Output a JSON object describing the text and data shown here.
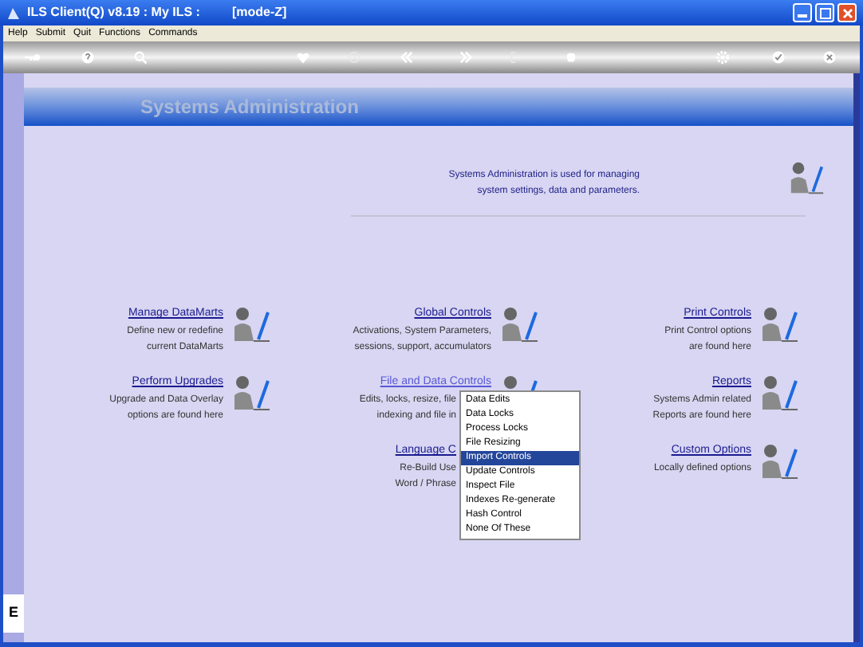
{
  "window": {
    "title": "ILS Client(Q) v8.19 : My ILS :",
    "mode": "[mode-Z]"
  },
  "menu_bar": [
    "Help",
    "Submit",
    "Quit",
    "Functions",
    "Commands"
  ],
  "page_title": "Systems Administration",
  "intro": [
    "Systems Administration is used for managing",
    "system settings, data and parameters."
  ],
  "sections": [
    {
      "title": "Manage DataMarts",
      "active": false,
      "lines": [
        "Define new or redefine",
        "current DataMarts"
      ]
    },
    {
      "title": "Global Controls",
      "active": false,
      "lines": [
        "Activations, System Parameters,",
        "sessions, support, accumulators"
      ]
    },
    {
      "title": "Print Controls",
      "active": false,
      "lines": [
        "Print Control options",
        "are found here"
      ]
    },
    {
      "title": "Perform Upgrades",
      "active": false,
      "lines": [
        "Upgrade and Data Overlay",
        "options are found here"
      ]
    },
    {
      "title": "File and Data Controls",
      "active": true,
      "lines": [
        "Edits, locks, resize, file",
        "indexing and file in"
      ]
    },
    {
      "title": "Reports",
      "active": false,
      "lines": [
        "Systems Admin related",
        "Reports are found here"
      ]
    },
    {
      "kind": "empty"
    },
    {
      "title": "Language C",
      "active": false,
      "lines": [
        "Re-Build Use",
        "Word / Phrase"
      ]
    },
    {
      "title": "Custom Options",
      "active": false,
      "lines": [
        "Locally defined options"
      ]
    }
  ],
  "popup_menu": [
    {
      "label": "Data Edits",
      "selected": false
    },
    {
      "label": "Data Locks",
      "selected": false
    },
    {
      "label": "Process Locks",
      "selected": false
    },
    {
      "label": "File Resizing",
      "selected": false
    },
    {
      "label": "Import Controls",
      "selected": true
    },
    {
      "label": "Update Controls",
      "selected": false
    },
    {
      "label": "Inspect File",
      "selected": false
    },
    {
      "label": "Indexes Re-generate",
      "selected": false
    },
    {
      "label": "Hash Control",
      "selected": false
    },
    {
      "label": "None Of These",
      "selected": false
    }
  ],
  "side_panel": {
    "letter": "E"
  }
}
